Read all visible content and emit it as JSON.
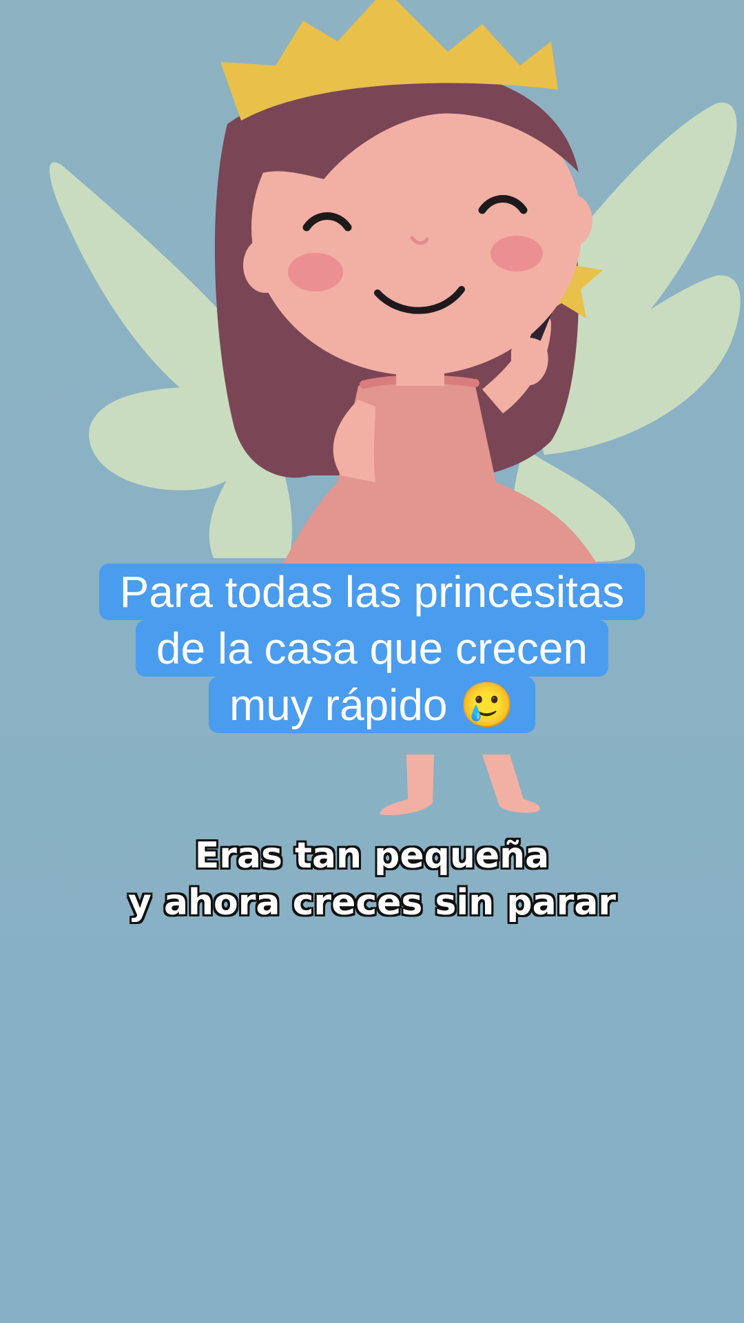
{
  "caption": {
    "lines": [
      "Para todas las princesitas",
      "de la casa que crecen",
      "muy rápido 🥲"
    ],
    "background_color": "#4a9cee",
    "text_color": "#ffffff"
  },
  "subtitle": {
    "lines": [
      "Eras tan pequeña",
      "y ahora creces sin parar"
    ]
  },
  "illustration": {
    "subject": "fairy-princess",
    "icon": "star-wand-icon"
  }
}
